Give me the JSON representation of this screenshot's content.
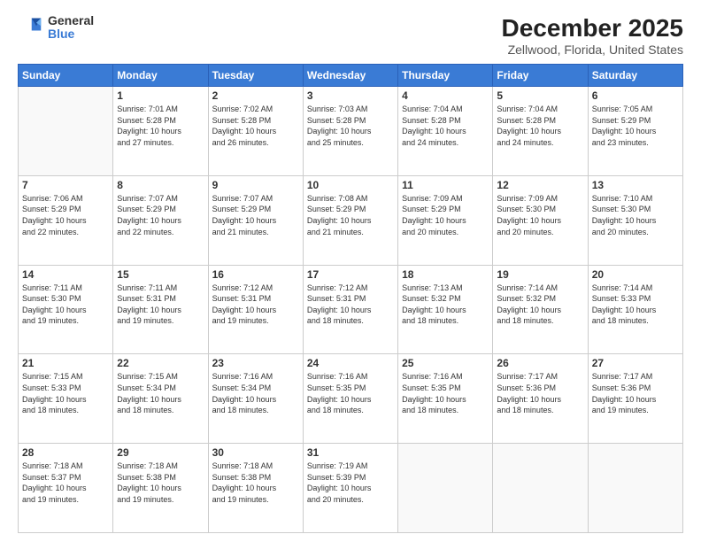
{
  "header": {
    "logo_line1": "General",
    "logo_line2": "Blue",
    "title": "December 2025",
    "subtitle": "Zellwood, Florida, United States"
  },
  "days_of_week": [
    "Sunday",
    "Monday",
    "Tuesday",
    "Wednesday",
    "Thursday",
    "Friday",
    "Saturday"
  ],
  "weeks": [
    [
      {
        "day": "",
        "info": ""
      },
      {
        "day": "1",
        "info": "Sunrise: 7:01 AM\nSunset: 5:28 PM\nDaylight: 10 hours\nand 27 minutes."
      },
      {
        "day": "2",
        "info": "Sunrise: 7:02 AM\nSunset: 5:28 PM\nDaylight: 10 hours\nand 26 minutes."
      },
      {
        "day": "3",
        "info": "Sunrise: 7:03 AM\nSunset: 5:28 PM\nDaylight: 10 hours\nand 25 minutes."
      },
      {
        "day": "4",
        "info": "Sunrise: 7:04 AM\nSunset: 5:28 PM\nDaylight: 10 hours\nand 24 minutes."
      },
      {
        "day": "5",
        "info": "Sunrise: 7:04 AM\nSunset: 5:28 PM\nDaylight: 10 hours\nand 24 minutes."
      },
      {
        "day": "6",
        "info": "Sunrise: 7:05 AM\nSunset: 5:29 PM\nDaylight: 10 hours\nand 23 minutes."
      }
    ],
    [
      {
        "day": "7",
        "info": "Sunrise: 7:06 AM\nSunset: 5:29 PM\nDaylight: 10 hours\nand 22 minutes."
      },
      {
        "day": "8",
        "info": "Sunrise: 7:07 AM\nSunset: 5:29 PM\nDaylight: 10 hours\nand 22 minutes."
      },
      {
        "day": "9",
        "info": "Sunrise: 7:07 AM\nSunset: 5:29 PM\nDaylight: 10 hours\nand 21 minutes."
      },
      {
        "day": "10",
        "info": "Sunrise: 7:08 AM\nSunset: 5:29 PM\nDaylight: 10 hours\nand 21 minutes."
      },
      {
        "day": "11",
        "info": "Sunrise: 7:09 AM\nSunset: 5:29 PM\nDaylight: 10 hours\nand 20 minutes."
      },
      {
        "day": "12",
        "info": "Sunrise: 7:09 AM\nSunset: 5:30 PM\nDaylight: 10 hours\nand 20 minutes."
      },
      {
        "day": "13",
        "info": "Sunrise: 7:10 AM\nSunset: 5:30 PM\nDaylight: 10 hours\nand 20 minutes."
      }
    ],
    [
      {
        "day": "14",
        "info": "Sunrise: 7:11 AM\nSunset: 5:30 PM\nDaylight: 10 hours\nand 19 minutes."
      },
      {
        "day": "15",
        "info": "Sunrise: 7:11 AM\nSunset: 5:31 PM\nDaylight: 10 hours\nand 19 minutes."
      },
      {
        "day": "16",
        "info": "Sunrise: 7:12 AM\nSunset: 5:31 PM\nDaylight: 10 hours\nand 19 minutes."
      },
      {
        "day": "17",
        "info": "Sunrise: 7:12 AM\nSunset: 5:31 PM\nDaylight: 10 hours\nand 18 minutes."
      },
      {
        "day": "18",
        "info": "Sunrise: 7:13 AM\nSunset: 5:32 PM\nDaylight: 10 hours\nand 18 minutes."
      },
      {
        "day": "19",
        "info": "Sunrise: 7:14 AM\nSunset: 5:32 PM\nDaylight: 10 hours\nand 18 minutes."
      },
      {
        "day": "20",
        "info": "Sunrise: 7:14 AM\nSunset: 5:33 PM\nDaylight: 10 hours\nand 18 minutes."
      }
    ],
    [
      {
        "day": "21",
        "info": "Sunrise: 7:15 AM\nSunset: 5:33 PM\nDaylight: 10 hours\nand 18 minutes."
      },
      {
        "day": "22",
        "info": "Sunrise: 7:15 AM\nSunset: 5:34 PM\nDaylight: 10 hours\nand 18 minutes."
      },
      {
        "day": "23",
        "info": "Sunrise: 7:16 AM\nSunset: 5:34 PM\nDaylight: 10 hours\nand 18 minutes."
      },
      {
        "day": "24",
        "info": "Sunrise: 7:16 AM\nSunset: 5:35 PM\nDaylight: 10 hours\nand 18 minutes."
      },
      {
        "day": "25",
        "info": "Sunrise: 7:16 AM\nSunset: 5:35 PM\nDaylight: 10 hours\nand 18 minutes."
      },
      {
        "day": "26",
        "info": "Sunrise: 7:17 AM\nSunset: 5:36 PM\nDaylight: 10 hours\nand 18 minutes."
      },
      {
        "day": "27",
        "info": "Sunrise: 7:17 AM\nSunset: 5:36 PM\nDaylight: 10 hours\nand 19 minutes."
      }
    ],
    [
      {
        "day": "28",
        "info": "Sunrise: 7:18 AM\nSunset: 5:37 PM\nDaylight: 10 hours\nand 19 minutes."
      },
      {
        "day": "29",
        "info": "Sunrise: 7:18 AM\nSunset: 5:38 PM\nDaylight: 10 hours\nand 19 minutes."
      },
      {
        "day": "30",
        "info": "Sunrise: 7:18 AM\nSunset: 5:38 PM\nDaylight: 10 hours\nand 19 minutes."
      },
      {
        "day": "31",
        "info": "Sunrise: 7:19 AM\nSunset: 5:39 PM\nDaylight: 10 hours\nand 20 minutes."
      },
      {
        "day": "",
        "info": ""
      },
      {
        "day": "",
        "info": ""
      },
      {
        "day": "",
        "info": ""
      }
    ]
  ]
}
